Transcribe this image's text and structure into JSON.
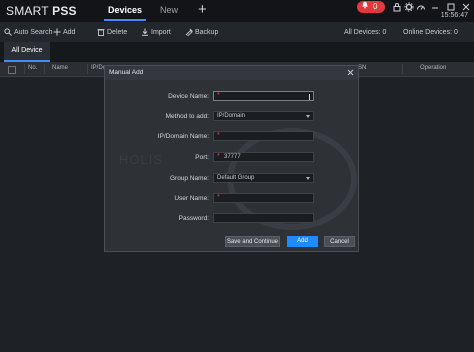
{
  "app": {
    "brand_a": "SMART ",
    "brand_b": "PSS",
    "clock": "15:56:47"
  },
  "tabs": [
    {
      "label": "Devices"
    },
    {
      "label": "New"
    }
  ],
  "alarm": {
    "count": "0"
  },
  "toolbar": {
    "auto_search": "Auto Search",
    "add": "Add",
    "delete": "Delete",
    "import": "Import",
    "backup": "Backup",
    "all_devices": "All Devices: 0",
    "online_devices": "Online Devices: 0"
  },
  "subtab": {
    "label": "All Device"
  },
  "table": {
    "headers": [
      "No.",
      "Name",
      "IP/Do",
      "SN",
      "Operation"
    ]
  },
  "dialog": {
    "title": "Manual Add",
    "labels": {
      "device_name": "Device Name:",
      "method": "Method to add:",
      "ip_domain": "IP/Domain Name:",
      "port": "Port:",
      "group": "Group Name:",
      "user": "User Name:",
      "password": "Password:"
    },
    "values": {
      "method": "IP/Domain",
      "port": "37777",
      "group": "Default Group"
    },
    "buttons": {
      "save_continue": "Save and Continue",
      "add": "Add",
      "cancel": "Cancel"
    }
  },
  "watermark": "HOLIS",
  "colors": {
    "accent": "#1e8cff",
    "alarm": "#e23a3a",
    "required": "#ff3b3b"
  }
}
